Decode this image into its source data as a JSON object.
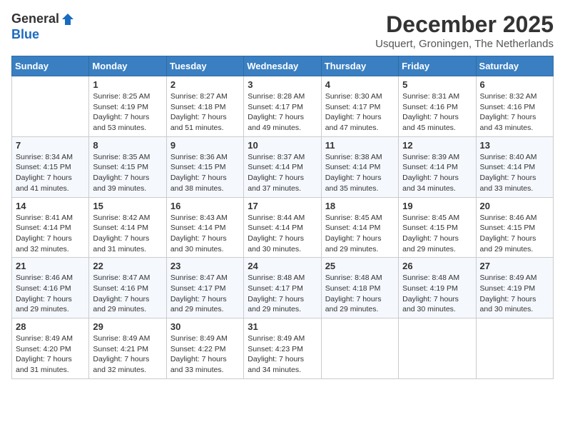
{
  "header": {
    "logo_general": "General",
    "logo_blue": "Blue",
    "month_title": "December 2025",
    "location": "Usquert, Groningen, The Netherlands"
  },
  "weekdays": [
    "Sunday",
    "Monday",
    "Tuesday",
    "Wednesday",
    "Thursday",
    "Friday",
    "Saturday"
  ],
  "weeks": [
    [
      {
        "day": "",
        "sunrise": "",
        "sunset": "",
        "daylight": ""
      },
      {
        "day": "1",
        "sunrise": "Sunrise: 8:25 AM",
        "sunset": "Sunset: 4:19 PM",
        "daylight": "Daylight: 7 hours and 53 minutes."
      },
      {
        "day": "2",
        "sunrise": "Sunrise: 8:27 AM",
        "sunset": "Sunset: 4:18 PM",
        "daylight": "Daylight: 7 hours and 51 minutes."
      },
      {
        "day": "3",
        "sunrise": "Sunrise: 8:28 AM",
        "sunset": "Sunset: 4:17 PM",
        "daylight": "Daylight: 7 hours and 49 minutes."
      },
      {
        "day": "4",
        "sunrise": "Sunrise: 8:30 AM",
        "sunset": "Sunset: 4:17 PM",
        "daylight": "Daylight: 7 hours and 47 minutes."
      },
      {
        "day": "5",
        "sunrise": "Sunrise: 8:31 AM",
        "sunset": "Sunset: 4:16 PM",
        "daylight": "Daylight: 7 hours and 45 minutes."
      },
      {
        "day": "6",
        "sunrise": "Sunrise: 8:32 AM",
        "sunset": "Sunset: 4:16 PM",
        "daylight": "Daylight: 7 hours and 43 minutes."
      }
    ],
    [
      {
        "day": "7",
        "sunrise": "Sunrise: 8:34 AM",
        "sunset": "Sunset: 4:15 PM",
        "daylight": "Daylight: 7 hours and 41 minutes."
      },
      {
        "day": "8",
        "sunrise": "Sunrise: 8:35 AM",
        "sunset": "Sunset: 4:15 PM",
        "daylight": "Daylight: 7 hours and 39 minutes."
      },
      {
        "day": "9",
        "sunrise": "Sunrise: 8:36 AM",
        "sunset": "Sunset: 4:15 PM",
        "daylight": "Daylight: 7 hours and 38 minutes."
      },
      {
        "day": "10",
        "sunrise": "Sunrise: 8:37 AM",
        "sunset": "Sunset: 4:14 PM",
        "daylight": "Daylight: 7 hours and 37 minutes."
      },
      {
        "day": "11",
        "sunrise": "Sunrise: 8:38 AM",
        "sunset": "Sunset: 4:14 PM",
        "daylight": "Daylight: 7 hours and 35 minutes."
      },
      {
        "day": "12",
        "sunrise": "Sunrise: 8:39 AM",
        "sunset": "Sunset: 4:14 PM",
        "daylight": "Daylight: 7 hours and 34 minutes."
      },
      {
        "day": "13",
        "sunrise": "Sunrise: 8:40 AM",
        "sunset": "Sunset: 4:14 PM",
        "daylight": "Daylight: 7 hours and 33 minutes."
      }
    ],
    [
      {
        "day": "14",
        "sunrise": "Sunrise: 8:41 AM",
        "sunset": "Sunset: 4:14 PM",
        "daylight": "Daylight: 7 hours and 32 minutes."
      },
      {
        "day": "15",
        "sunrise": "Sunrise: 8:42 AM",
        "sunset": "Sunset: 4:14 PM",
        "daylight": "Daylight: 7 hours and 31 minutes."
      },
      {
        "day": "16",
        "sunrise": "Sunrise: 8:43 AM",
        "sunset": "Sunset: 4:14 PM",
        "daylight": "Daylight: 7 hours and 30 minutes."
      },
      {
        "day": "17",
        "sunrise": "Sunrise: 8:44 AM",
        "sunset": "Sunset: 4:14 PM",
        "daylight": "Daylight: 7 hours and 30 minutes."
      },
      {
        "day": "18",
        "sunrise": "Sunrise: 8:45 AM",
        "sunset": "Sunset: 4:14 PM",
        "daylight": "Daylight: 7 hours and 29 minutes."
      },
      {
        "day": "19",
        "sunrise": "Sunrise: 8:45 AM",
        "sunset": "Sunset: 4:15 PM",
        "daylight": "Daylight: 7 hours and 29 minutes."
      },
      {
        "day": "20",
        "sunrise": "Sunrise: 8:46 AM",
        "sunset": "Sunset: 4:15 PM",
        "daylight": "Daylight: 7 hours and 29 minutes."
      }
    ],
    [
      {
        "day": "21",
        "sunrise": "Sunrise: 8:46 AM",
        "sunset": "Sunset: 4:16 PM",
        "daylight": "Daylight: 7 hours and 29 minutes."
      },
      {
        "day": "22",
        "sunrise": "Sunrise: 8:47 AM",
        "sunset": "Sunset: 4:16 PM",
        "daylight": "Daylight: 7 hours and 29 minutes."
      },
      {
        "day": "23",
        "sunrise": "Sunrise: 8:47 AM",
        "sunset": "Sunset: 4:17 PM",
        "daylight": "Daylight: 7 hours and 29 minutes."
      },
      {
        "day": "24",
        "sunrise": "Sunrise: 8:48 AM",
        "sunset": "Sunset: 4:17 PM",
        "daylight": "Daylight: 7 hours and 29 minutes."
      },
      {
        "day": "25",
        "sunrise": "Sunrise: 8:48 AM",
        "sunset": "Sunset: 4:18 PM",
        "daylight": "Daylight: 7 hours and 29 minutes."
      },
      {
        "day": "26",
        "sunrise": "Sunrise: 8:48 AM",
        "sunset": "Sunset: 4:19 PM",
        "daylight": "Daylight: 7 hours and 30 minutes."
      },
      {
        "day": "27",
        "sunrise": "Sunrise: 8:49 AM",
        "sunset": "Sunset: 4:19 PM",
        "daylight": "Daylight: 7 hours and 30 minutes."
      }
    ],
    [
      {
        "day": "28",
        "sunrise": "Sunrise: 8:49 AM",
        "sunset": "Sunset: 4:20 PM",
        "daylight": "Daylight: 7 hours and 31 minutes."
      },
      {
        "day": "29",
        "sunrise": "Sunrise: 8:49 AM",
        "sunset": "Sunset: 4:21 PM",
        "daylight": "Daylight: 7 hours and 32 minutes."
      },
      {
        "day": "30",
        "sunrise": "Sunrise: 8:49 AM",
        "sunset": "Sunset: 4:22 PM",
        "daylight": "Daylight: 7 hours and 33 minutes."
      },
      {
        "day": "31",
        "sunrise": "Sunrise: 8:49 AM",
        "sunset": "Sunset: 4:23 PM",
        "daylight": "Daylight: 7 hours and 34 minutes."
      },
      {
        "day": "",
        "sunrise": "",
        "sunset": "",
        "daylight": ""
      },
      {
        "day": "",
        "sunrise": "",
        "sunset": "",
        "daylight": ""
      },
      {
        "day": "",
        "sunrise": "",
        "sunset": "",
        "daylight": ""
      }
    ]
  ]
}
